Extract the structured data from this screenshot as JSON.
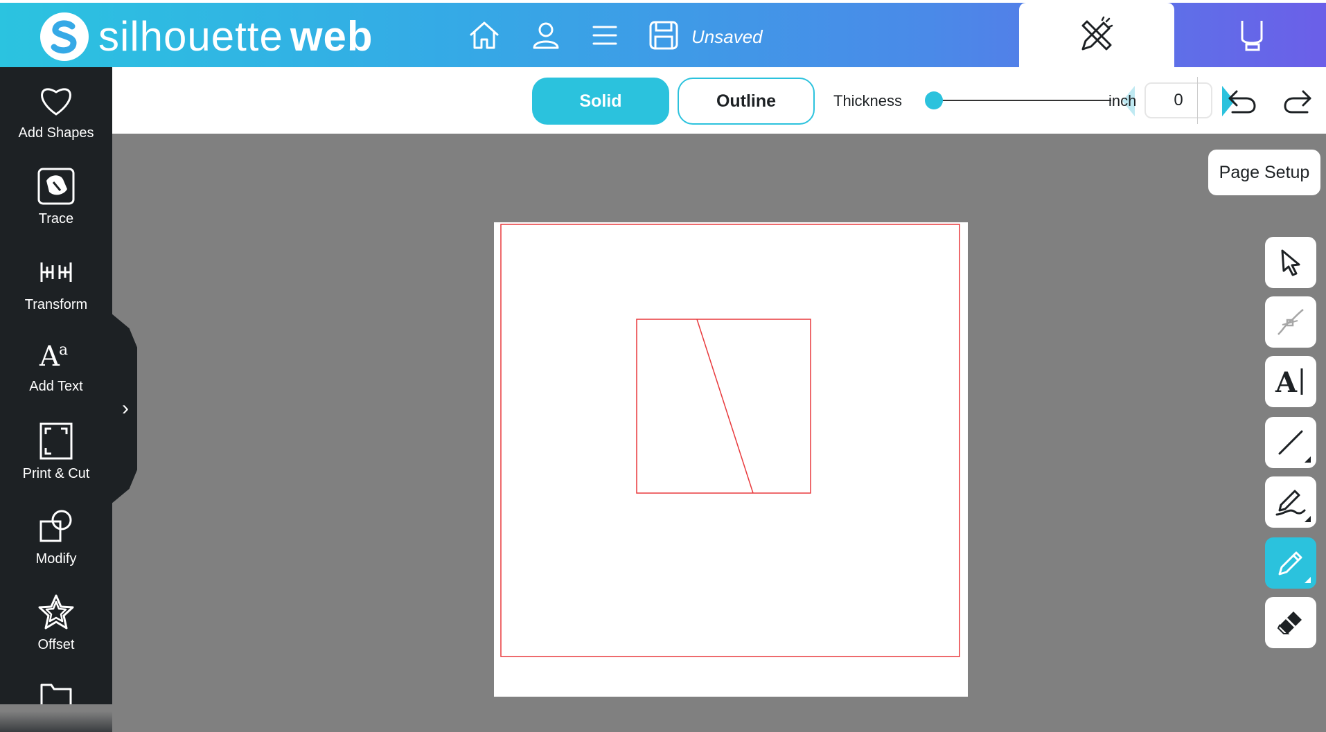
{
  "header": {
    "logo_text_light": "silhouette",
    "logo_text_bold": "web",
    "home_icon": "home-icon",
    "account_icon": "user-icon",
    "menu_icon": "hamburger-menu-icon",
    "save_icon": "save-disk-icon",
    "save_status": "Unsaved",
    "tabs": [
      {
        "name": "design",
        "icon": "design-pencil-ruler-icon",
        "active": true
      },
      {
        "name": "send",
        "icon": "cutter-icon",
        "active": false
      }
    ]
  },
  "sidebar": {
    "items": [
      {
        "label": "Add Shapes",
        "icon": "heart-icon"
      },
      {
        "label": "Trace",
        "icon": "trace-image-icon"
      },
      {
        "label": "Transform",
        "icon": "transform-icon"
      },
      {
        "label": "Add Text",
        "icon": "add-text-icon"
      },
      {
        "label": "Print & Cut",
        "icon": "print-cut-icon"
      },
      {
        "label": "Modify",
        "icon": "modify-shapes-icon"
      },
      {
        "label": "Offset",
        "icon": "star-icon"
      },
      {
        "label": "",
        "icon": "folder-icon"
      }
    ],
    "expand_glyph": "›"
  },
  "toolbar": {
    "solid_label": "Solid",
    "outline_label": "Outline",
    "thickness_label": "Thickness",
    "thickness_value": "0",
    "thickness_slider_level": 0,
    "unit_label": "inch",
    "undo_icon": "undo-icon",
    "redo_icon": "redo-icon"
  },
  "page_setup_label": "Page Setup",
  "tools": [
    {
      "name": "select",
      "icon": "pointer-arrow-icon",
      "active": false
    },
    {
      "name": "edit-points",
      "icon": "edit-points-icon",
      "active": false
    },
    {
      "name": "text",
      "icon": "text-cursor-icon",
      "active": false
    },
    {
      "name": "line",
      "icon": "line-icon",
      "active": false
    },
    {
      "name": "freehand",
      "icon": "freehand-pen-icon",
      "active": false
    },
    {
      "name": "pencil",
      "icon": "pencil-icon",
      "active": true
    },
    {
      "name": "eraser",
      "icon": "eraser-icon",
      "active": false
    }
  ],
  "colors": {
    "accent": "#2bc2dd",
    "sidebar_bg": "#1d2124",
    "workspace_bg": "#808080",
    "cut_line": "#e8393c"
  }
}
